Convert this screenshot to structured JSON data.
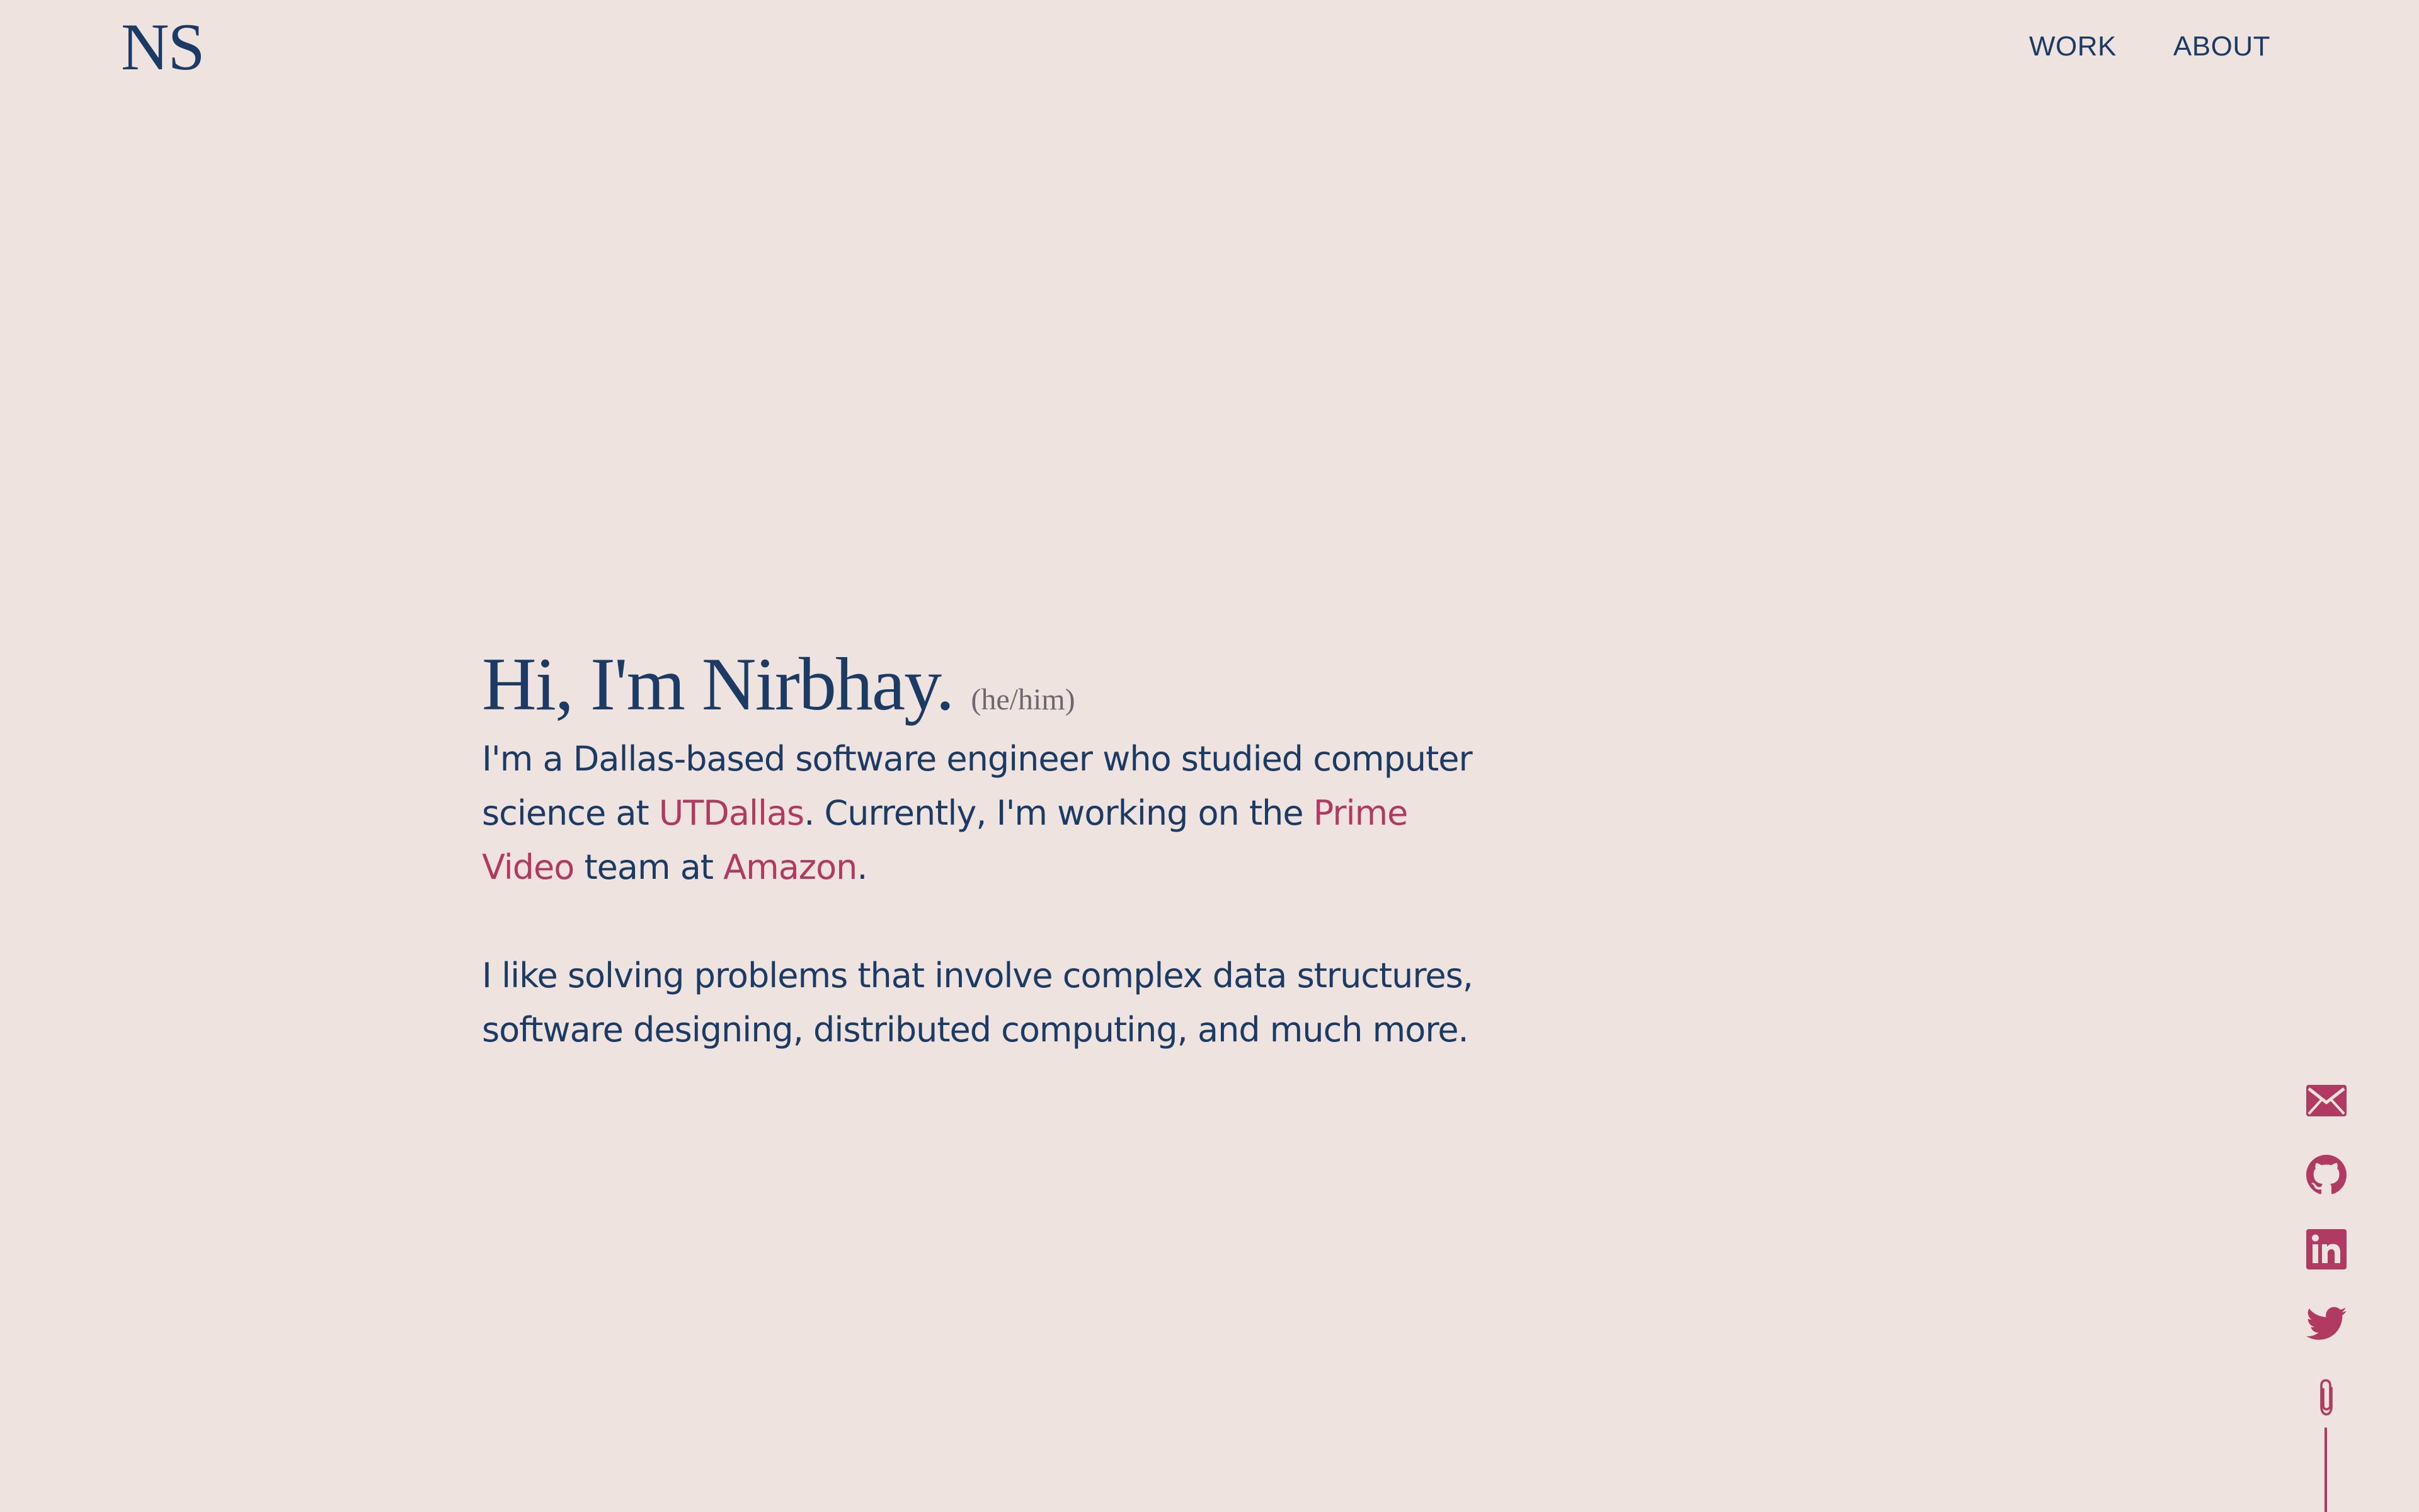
{
  "header": {
    "logo": "NS",
    "nav": [
      {
        "label": "WORK"
      },
      {
        "label": "ABOUT"
      }
    ]
  },
  "hero": {
    "greeting": "Hi, I'm Nirbhay.",
    "pronouns": "(he/him)",
    "intro": {
      "part1": "I'm a Dallas-based software engineer who studied computer science at ",
      "link1": "UTDallas",
      "part2": ". Currently, I'm working on the ",
      "link2": "Prime Video",
      "part3": " team at ",
      "link3": "Amazon",
      "part4": "."
    },
    "interests": "I like solving problems that involve complex data structures, software designing, distributed computing, and much more."
  },
  "social": [
    {
      "icon": "email-icon"
    },
    {
      "icon": "github-icon"
    },
    {
      "icon": "linkedin-icon"
    },
    {
      "icon": "twitter-icon"
    },
    {
      "icon": "paperclip-icon"
    }
  ],
  "colors": {
    "background": "#EEE3DF",
    "primary": "#1B3A64",
    "accent": "#B03A61",
    "muted": "#6E6770"
  }
}
